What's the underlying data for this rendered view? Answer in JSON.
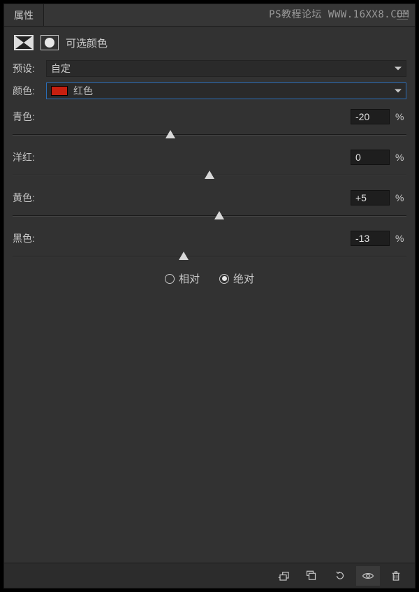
{
  "watermark": "PS教程论坛 WWW.16XX8.COM",
  "tab": {
    "title": "属性"
  },
  "adjustment": {
    "title": "可选颜色"
  },
  "preset": {
    "label": "预设:",
    "value": "自定"
  },
  "colors": {
    "label": "颜色:",
    "value": "红色",
    "swatch": "#c61f0f"
  },
  "sliders": [
    {
      "label": "青色:",
      "value": "-20",
      "percent": -20
    },
    {
      "label": "洋红:",
      "value": "0",
      "percent": 0
    },
    {
      "label": "黄色:",
      "value": "+5",
      "percent": 5
    },
    {
      "label": "黑色:",
      "value": "-13",
      "percent": -13
    }
  ],
  "unit": "%",
  "method": {
    "options": [
      {
        "label": "相对",
        "checked": false
      },
      {
        "label": "绝对",
        "checked": true
      }
    ]
  }
}
